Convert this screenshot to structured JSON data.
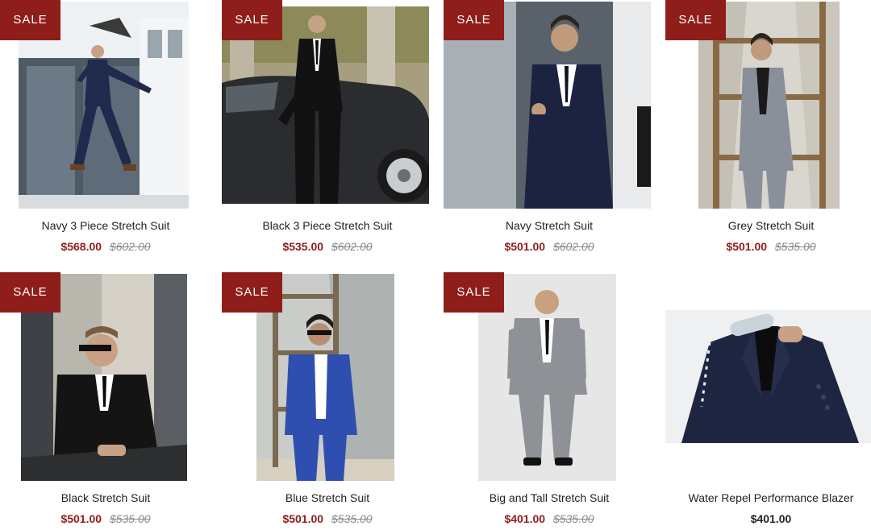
{
  "badge_label": "SALE",
  "colors": {
    "badge_bg": "#8f1d1a",
    "sale_price": "#8f1d1a",
    "old_price": "#8a8a8a",
    "title_text": "#222222"
  },
  "products": [
    {
      "title": "Navy 3 Piece Stretch Suit",
      "price": "$568.00",
      "compare_price": "$602.00",
      "on_sale": true,
      "suit_color": "#1f2a4d"
    },
    {
      "title": "Black 3 Piece Stretch Suit",
      "price": "$535.00",
      "compare_price": "$602.00",
      "on_sale": true,
      "suit_color": "#141414"
    },
    {
      "title": "Navy Stretch Suit",
      "price": "$501.00",
      "compare_price": "$602.00",
      "on_sale": true,
      "suit_color": "#1b2340"
    },
    {
      "title": "Grey Stretch Suit",
      "price": "$501.00",
      "compare_price": "$535.00",
      "on_sale": true,
      "suit_color": "#8a9099"
    },
    {
      "title": "Black Stretch Suit",
      "price": "$501.00",
      "compare_price": "$535.00",
      "on_sale": true,
      "suit_color": "#141414"
    },
    {
      "title": "Blue Stretch Suit",
      "price": "$501.00",
      "compare_price": "$535.00",
      "on_sale": true,
      "suit_color": "#2f4fb0"
    },
    {
      "title": "Big and Tall Stretch Suit",
      "price": "$401.00",
      "compare_price": "$535.00",
      "on_sale": true,
      "suit_color": "#8e9296"
    },
    {
      "title": "Water Repel Performance Blazer",
      "price": "$401.00",
      "on_sale": false,
      "suit_color": "#1e2540"
    }
  ]
}
